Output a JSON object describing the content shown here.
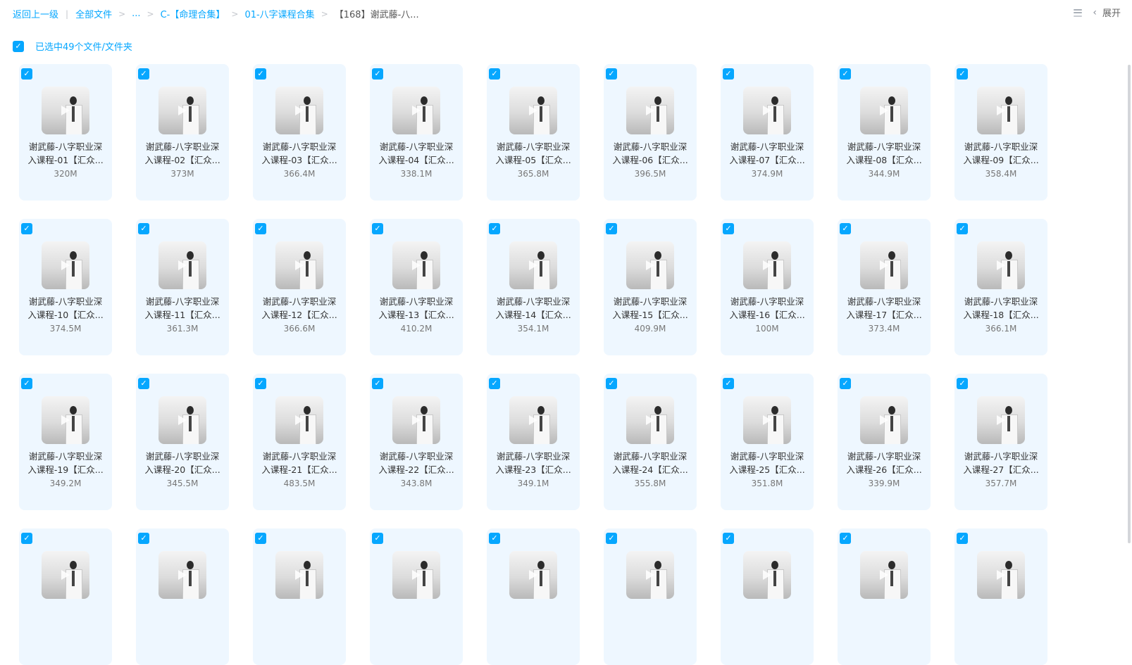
{
  "breadcrumb": {
    "back": "返回上一级",
    "all_files": "全部文件",
    "ellipsis": "...",
    "sep": ">",
    "divider": "|",
    "c_folder": "C-【命理合集】",
    "course_folder": "01-八字课程合集",
    "current": "【168】谢武藤-八..."
  },
  "toolbar": {
    "expand_label": "展开",
    "chevron": "‹"
  },
  "selection": {
    "check": "✓",
    "text": "已选中49个文件/文件夹"
  },
  "files": [
    {
      "line1": "谢武藤-八字职业深",
      "line2": "入课程-01【汇众...",
      "size": "320M"
    },
    {
      "line1": "谢武藤-八字职业深",
      "line2": "入课程-02【汇众...",
      "size": "373M"
    },
    {
      "line1": "谢武藤-八字职业深",
      "line2": "入课程-03【汇众...",
      "size": "366.4M"
    },
    {
      "line1": "谢武藤-八字职业深",
      "line2": "入课程-04【汇众...",
      "size": "338.1M"
    },
    {
      "line1": "谢武藤-八字职业深",
      "line2": "入课程-05【汇众...",
      "size": "365.8M"
    },
    {
      "line1": "谢武藤-八字职业深",
      "line2": "入课程-06【汇众...",
      "size": "396.5M"
    },
    {
      "line1": "谢武藤-八字职业深",
      "line2": "入课程-07【汇众...",
      "size": "374.9M"
    },
    {
      "line1": "谢武藤-八字职业深",
      "line2": "入课程-08【汇众...",
      "size": "344.9M"
    },
    {
      "line1": "谢武藤-八字职业深",
      "line2": "入课程-09【汇众...",
      "size": "358.4M"
    },
    {
      "line1": "谢武藤-八字职业深",
      "line2": "入课程-10【汇众...",
      "size": "374.5M"
    },
    {
      "line1": "谢武藤-八字职业深",
      "line2": "入课程-11【汇众...",
      "size": "361.3M"
    },
    {
      "line1": "谢武藤-八字职业深",
      "line2": "入课程-12【汇众...",
      "size": "366.6M"
    },
    {
      "line1": "谢武藤-八字职业深",
      "line2": "入课程-13【汇众...",
      "size": "410.2M"
    },
    {
      "line1": "谢武藤-八字职业深",
      "line2": "入课程-14【汇众...",
      "size": "354.1M"
    },
    {
      "line1": "谢武藤-八字职业深",
      "line2": "入课程-15【汇众...",
      "size": "409.9M"
    },
    {
      "line1": "谢武藤-八字职业深",
      "line2": "入课程-16【汇众...",
      "size": "100M"
    },
    {
      "line1": "谢武藤-八字职业深",
      "line2": "入课程-17【汇众...",
      "size": "373.4M"
    },
    {
      "line1": "谢武藤-八字职业深",
      "line2": "入课程-18【汇众...",
      "size": "366.1M"
    },
    {
      "line1": "谢武藤-八字职业深",
      "line2": "入课程-19【汇众...",
      "size": "349.2M"
    },
    {
      "line1": "谢武藤-八字职业深",
      "line2": "入课程-20【汇众...",
      "size": "345.5M"
    },
    {
      "line1": "谢武藤-八字职业深",
      "line2": "入课程-21【汇众...",
      "size": "483.5M"
    },
    {
      "line1": "谢武藤-八字职业深",
      "line2": "入课程-22【汇众...",
      "size": "343.8M"
    },
    {
      "line1": "谢武藤-八字职业深",
      "line2": "入课程-23【汇众...",
      "size": "349.1M"
    },
    {
      "line1": "谢武藤-八字职业深",
      "line2": "入课程-24【汇众...",
      "size": "355.8M"
    },
    {
      "line1": "谢武藤-八字职业深",
      "line2": "入课程-25【汇众...",
      "size": "351.8M"
    },
    {
      "line1": "谢武藤-八字职业深",
      "line2": "入课程-26【汇众...",
      "size": "339.9M"
    },
    {
      "line1": "谢武藤-八字职业深",
      "line2": "入课程-27【汇众...",
      "size": "357.7M"
    },
    {
      "line1": "",
      "line2": "",
      "size": ""
    },
    {
      "line1": "",
      "line2": "",
      "size": ""
    },
    {
      "line1": "",
      "line2": "",
      "size": ""
    },
    {
      "line1": "",
      "line2": "",
      "size": ""
    },
    {
      "line1": "",
      "line2": "",
      "size": ""
    },
    {
      "line1": "",
      "line2": "",
      "size": ""
    },
    {
      "line1": "",
      "line2": "",
      "size": ""
    },
    {
      "line1": "",
      "line2": "",
      "size": ""
    },
    {
      "line1": "",
      "line2": "",
      "size": ""
    }
  ],
  "colors": {
    "accent": "#06a7ff",
    "card_bg": "#eef7ff"
  }
}
